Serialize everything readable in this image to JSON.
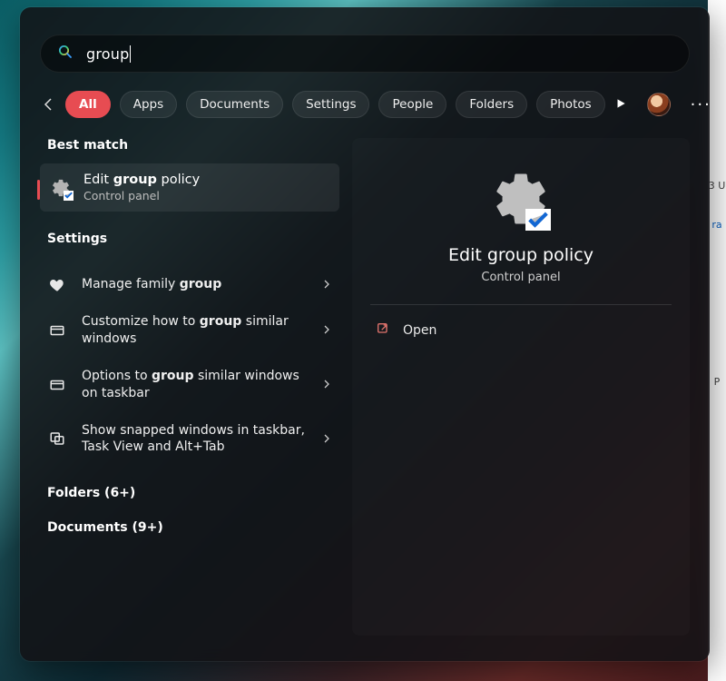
{
  "search": {
    "query": "group"
  },
  "filters": [
    {
      "label": "All",
      "active": true
    },
    {
      "label": "Apps",
      "active": false
    },
    {
      "label": "Documents",
      "active": false
    },
    {
      "label": "Settings",
      "active": false
    },
    {
      "label": "People",
      "active": false
    },
    {
      "label": "Folders",
      "active": false
    },
    {
      "label": "Photos",
      "active": false
    }
  ],
  "sections": {
    "best_match": "Best match",
    "settings": "Settings",
    "folders": "Folders (6+)",
    "documents": "Documents (9+)"
  },
  "best_match_result": {
    "title_pre": "Edit ",
    "title_bold": "group",
    "title_post": " policy",
    "subtitle": "Control panel"
  },
  "settings_items": [
    {
      "pre": "Manage family ",
      "bold": "group",
      "post": "",
      "icon": "heart"
    },
    {
      "pre": "Customize how to ",
      "bold": "group",
      "post": " similar windows",
      "icon": "window"
    },
    {
      "pre": "Options to ",
      "bold": "group",
      "post": " similar windows on taskbar",
      "icon": "window"
    },
    {
      "pre": "Show snapped windows in taskbar, Task View and Alt+Tab",
      "bold": "",
      "post": "",
      "icon": "snap"
    }
  ],
  "preview": {
    "title": "Edit group policy",
    "subtitle": "Control panel",
    "actions": [
      {
        "label": "Open"
      }
    ]
  }
}
